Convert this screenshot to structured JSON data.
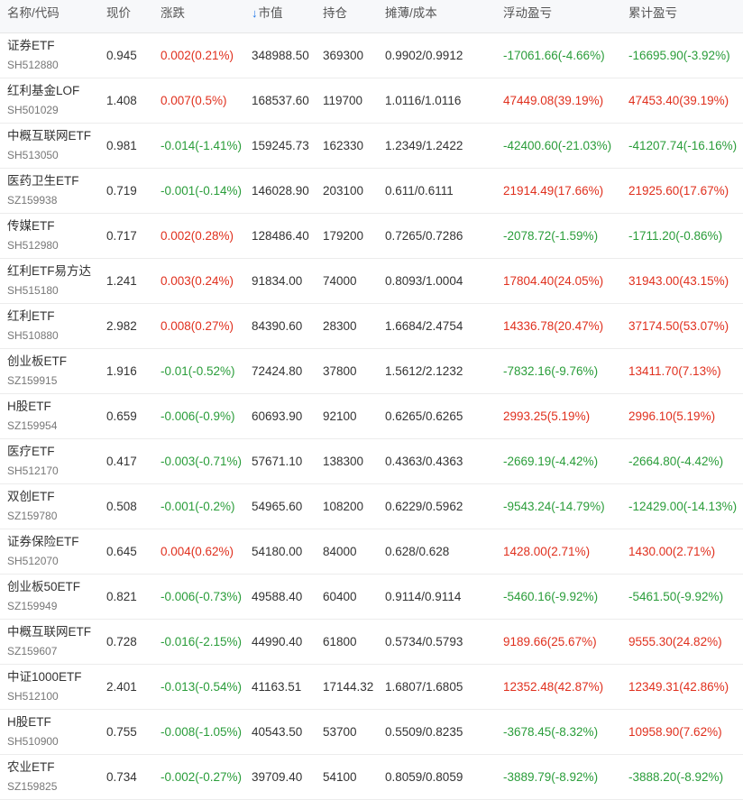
{
  "headers": {
    "name": "名称/代码",
    "price": "现价",
    "change": "涨跌",
    "market_value": "市值",
    "position": "持仓",
    "cost": "摊薄/成本",
    "floating_pl": "浮动盈亏",
    "total_pl": "累计盈亏",
    "sort_icon": "↓"
  },
  "colors": {
    "up": "#e0301e",
    "down": "#2a9d3a",
    "accent": "#1a73e8"
  },
  "rows": [
    {
      "name": "证券ETF",
      "code": "SH512880",
      "price": "0.945",
      "change": "0.002(0.21%)",
      "change_dir": "up",
      "mv": "348988.50",
      "pos": "369300",
      "cost": "0.9902/0.9912",
      "float": "-17061.66(-4.66%)",
      "float_dir": "down",
      "total": "-16695.90(-3.92%)",
      "total_dir": "down"
    },
    {
      "name": "红利基金LOF",
      "code": "SH501029",
      "price": "1.408",
      "change": "0.007(0.5%)",
      "change_dir": "up",
      "mv": "168537.60",
      "pos": "119700",
      "cost": "1.0116/1.0116",
      "float": "47449.08(39.19%)",
      "float_dir": "up",
      "total": "47453.40(39.19%)",
      "total_dir": "up"
    },
    {
      "name": "中概互联网ETF",
      "code": "SH513050",
      "price": "0.981",
      "change": "-0.014(-1.41%)",
      "change_dir": "down",
      "mv": "159245.73",
      "pos": "162330",
      "cost": "1.2349/1.2422",
      "float": "-42400.60(-21.03%)",
      "float_dir": "down",
      "total": "-41207.74(-16.16%)",
      "total_dir": "down"
    },
    {
      "name": "医药卫生ETF",
      "code": "SZ159938",
      "price": "0.719",
      "change": "-0.001(-0.14%)",
      "change_dir": "down",
      "mv": "146028.90",
      "pos": "203100",
      "cost": "0.611/0.6111",
      "float": "21914.49(17.66%)",
      "float_dir": "up",
      "total": "21925.60(17.67%)",
      "total_dir": "up"
    },
    {
      "name": "传媒ETF",
      "code": "SH512980",
      "price": "0.717",
      "change": "0.002(0.28%)",
      "change_dir": "up",
      "mv": "128486.40",
      "pos": "179200",
      "cost": "0.7265/0.7286",
      "float": "-2078.72(-1.59%)",
      "float_dir": "down",
      "total": "-1711.20(-0.86%)",
      "total_dir": "down"
    },
    {
      "name": "红利ETF易方达",
      "code": "SH515180",
      "price": "1.241",
      "change": "0.003(0.24%)",
      "change_dir": "up",
      "mv": "91834.00",
      "pos": "74000",
      "cost": "0.8093/1.0004",
      "float": "17804.40(24.05%)",
      "float_dir": "up",
      "total": "31943.00(43.15%)",
      "total_dir": "up"
    },
    {
      "name": "红利ETF",
      "code": "SH510880",
      "price": "2.982",
      "change": "0.008(0.27%)",
      "change_dir": "up",
      "mv": "84390.60",
      "pos": "28300",
      "cost": "1.6684/2.4754",
      "float": "14336.78(20.47%)",
      "float_dir": "up",
      "total": "37174.50(53.07%)",
      "total_dir": "up"
    },
    {
      "name": "创业板ETF",
      "code": "SZ159915",
      "price": "1.916",
      "change": "-0.01(-0.52%)",
      "change_dir": "down",
      "mv": "72424.80",
      "pos": "37800",
      "cost": "1.5612/2.1232",
      "float": "-7832.16(-9.76%)",
      "float_dir": "down",
      "total": "13411.70(7.13%)",
      "total_dir": "up"
    },
    {
      "name": "H股ETF",
      "code": "SZ159954",
      "price": "0.659",
      "change": "-0.006(-0.9%)",
      "change_dir": "down",
      "mv": "60693.90",
      "pos": "92100",
      "cost": "0.6265/0.6265",
      "float": "2993.25(5.19%)",
      "float_dir": "up",
      "total": "2996.10(5.19%)",
      "total_dir": "up"
    },
    {
      "name": "医疗ETF",
      "code": "SH512170",
      "price": "0.417",
      "change": "-0.003(-0.71%)",
      "change_dir": "down",
      "mv": "57671.10",
      "pos": "138300",
      "cost": "0.4363/0.4363",
      "float": "-2669.19(-4.42%)",
      "float_dir": "down",
      "total": "-2664.80(-4.42%)",
      "total_dir": "down"
    },
    {
      "name": "双创ETF",
      "code": "SZ159780",
      "price": "0.508",
      "change": "-0.001(-0.2%)",
      "change_dir": "down",
      "mv": "54965.60",
      "pos": "108200",
      "cost": "0.6229/0.5962",
      "float": "-9543.24(-14.79%)",
      "float_dir": "down",
      "total": "-12429.00(-14.13%)",
      "total_dir": "down"
    },
    {
      "name": "证券保险ETF",
      "code": "SH512070",
      "price": "0.645",
      "change": "0.004(0.62%)",
      "change_dir": "up",
      "mv": "54180.00",
      "pos": "84000",
      "cost": "0.628/0.628",
      "float": "1428.00(2.71%)",
      "float_dir": "up",
      "total": "1430.00(2.71%)",
      "total_dir": "up"
    },
    {
      "name": "创业板50ETF",
      "code": "SZ159949",
      "price": "0.821",
      "change": "-0.006(-0.73%)",
      "change_dir": "down",
      "mv": "49588.40",
      "pos": "60400",
      "cost": "0.9114/0.9114",
      "float": "-5460.16(-9.92%)",
      "float_dir": "down",
      "total": "-5461.50(-9.92%)",
      "total_dir": "down"
    },
    {
      "name": "中概互联网ETF",
      "code": "SZ159607",
      "price": "0.728",
      "change": "-0.016(-2.15%)",
      "change_dir": "down",
      "mv": "44990.40",
      "pos": "61800",
      "cost": "0.5734/0.5793",
      "float": "9189.66(25.67%)",
      "float_dir": "up",
      "total": "9555.30(24.82%)",
      "total_dir": "up"
    },
    {
      "name": "中证1000ETF",
      "code": "SH512100",
      "price": "2.401",
      "change": "-0.013(-0.54%)",
      "change_dir": "down",
      "mv": "41163.51",
      "pos": "17144.32",
      "cost": "1.6807/1.6805",
      "float": "12352.48(42.87%)",
      "float_dir": "up",
      "total": "12349.31(42.86%)",
      "total_dir": "up"
    },
    {
      "name": "H股ETF",
      "code": "SH510900",
      "price": "0.755",
      "change": "-0.008(-1.05%)",
      "change_dir": "down",
      "mv": "40543.50",
      "pos": "53700",
      "cost": "0.5509/0.8235",
      "float": "-3678.45(-8.32%)",
      "float_dir": "down",
      "total": "10958.90(7.62%)",
      "total_dir": "up"
    },
    {
      "name": "农业ETF",
      "code": "SZ159825",
      "price": "0.734",
      "change": "-0.002(-0.27%)",
      "change_dir": "down",
      "mv": "39709.40",
      "pos": "54100",
      "cost": "0.8059/0.8059",
      "float": "-3889.79(-8.92%)",
      "float_dir": "down",
      "total": "-3888.20(-8.92%)",
      "total_dir": "down"
    }
  ]
}
